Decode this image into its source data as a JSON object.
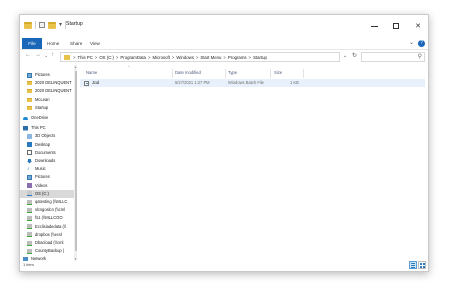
{
  "window": {
    "title": "Startup"
  },
  "ribbon": {
    "tabs": [
      {
        "label": "File"
      },
      {
        "label": "Home"
      },
      {
        "label": "Share"
      },
      {
        "label": "View"
      }
    ]
  },
  "address": {
    "crumbs": [
      "This PC",
      "OS (C:)",
      "ProgramData",
      "Microsoft",
      "Windows",
      "Start Menu",
      "Programs",
      "Startup"
    ],
    "separator": ">"
  },
  "nav_pane": {
    "items": [
      {
        "label": "Pictures",
        "icon": "pictures-icon"
      },
      {
        "label": "2020 DELINQUENT",
        "icon": "folder-icon"
      },
      {
        "label": "2020 DELINQUENT",
        "icon": "folder-icon"
      },
      {
        "label": "McLean",
        "icon": "folder-icon"
      },
      {
        "label": "Startup",
        "icon": "folder-icon"
      },
      {
        "label": "OneDrive",
        "icon": "onedrive-icon"
      },
      {
        "label": "This PC",
        "icon": "this-pc-icon"
      },
      {
        "label": "3D Objects",
        "icon": "3d-objects-icon"
      },
      {
        "label": "Desktop",
        "icon": "desktop-icon"
      },
      {
        "label": "Documents",
        "icon": "documents-icon"
      },
      {
        "label": "Downloads",
        "icon": "downloads-icon"
      },
      {
        "label": "Music",
        "icon": "music-icon"
      },
      {
        "label": "Pictures",
        "icon": "pictures-icon"
      },
      {
        "label": "Videos",
        "icon": "videos-icon"
      },
      {
        "label": "OS (C:)",
        "icon": "drive-icon"
      },
      {
        "label": "qatesting (\\\\MLLC",
        "icon": "network-drive-icon"
      },
      {
        "label": "slcsgoslcn (\\\\cml",
        "icon": "network-drive-icon"
      },
      {
        "label": "fs1 (\\\\MLLCOO",
        "icon": "network-drive-icon"
      },
      {
        "label": "Ecclisiadedata (\\\\",
        "icon": "network-drive-icon"
      },
      {
        "label": "dropbox (\\\\ecsl",
        "icon": "network-drive-icon"
      },
      {
        "label": "Dbacload (\\\\cml",
        "icon": "network-drive-icon"
      },
      {
        "label": "CountyBackup (",
        "icon": "network-drive-icon"
      },
      {
        "label": "Network",
        "icon": "network-icon"
      }
    ],
    "selected_index": 14
  },
  "columns": {
    "name": "Name",
    "date": "Date modified",
    "type": "Type",
    "size": "Size"
  },
  "files": [
    {
      "name": "Jcal",
      "date": "5/27/2021 1:27 PM",
      "type": "Windows Batch File",
      "size": "1 KB",
      "icon": "batch-file-icon"
    }
  ],
  "status": {
    "text": "1 item"
  }
}
